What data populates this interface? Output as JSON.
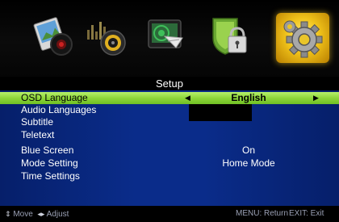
{
  "menu_bar": {
    "items": [
      {
        "name": "picture",
        "icon": "picture-icon"
      },
      {
        "name": "sound",
        "icon": "sound-icon"
      },
      {
        "name": "channel",
        "icon": "channel-icon"
      },
      {
        "name": "lock",
        "icon": "lock-icon"
      },
      {
        "name": "setup",
        "icon": "gear-icon",
        "active": true
      }
    ]
  },
  "setup": {
    "title": "Setup",
    "rows": [
      {
        "label": "OSD Language",
        "value": "English",
        "selected": true
      },
      {
        "label": "Audio Languages",
        "value": ""
      },
      {
        "label": "Subtitle",
        "value": ""
      },
      {
        "label": "Teletext",
        "value": ""
      },
      {
        "label": "Blue Screen",
        "value": "On"
      },
      {
        "label": "Mode Setting",
        "value": "Home Mode"
      },
      {
        "label": "Time Settings",
        "value": ""
      },
      {
        "label": "",
        "value": ""
      }
    ]
  },
  "footer": {
    "move_label": "Move",
    "adjust_label": "Adjust",
    "menu_hint": "MENU: Return",
    "exit_hint": "EXIT: Exit"
  },
  "colors": {
    "panel_blue": "#0a2c8a",
    "highlight_green": "#8ed63a",
    "active_tab_gold": "#f0c21a"
  }
}
